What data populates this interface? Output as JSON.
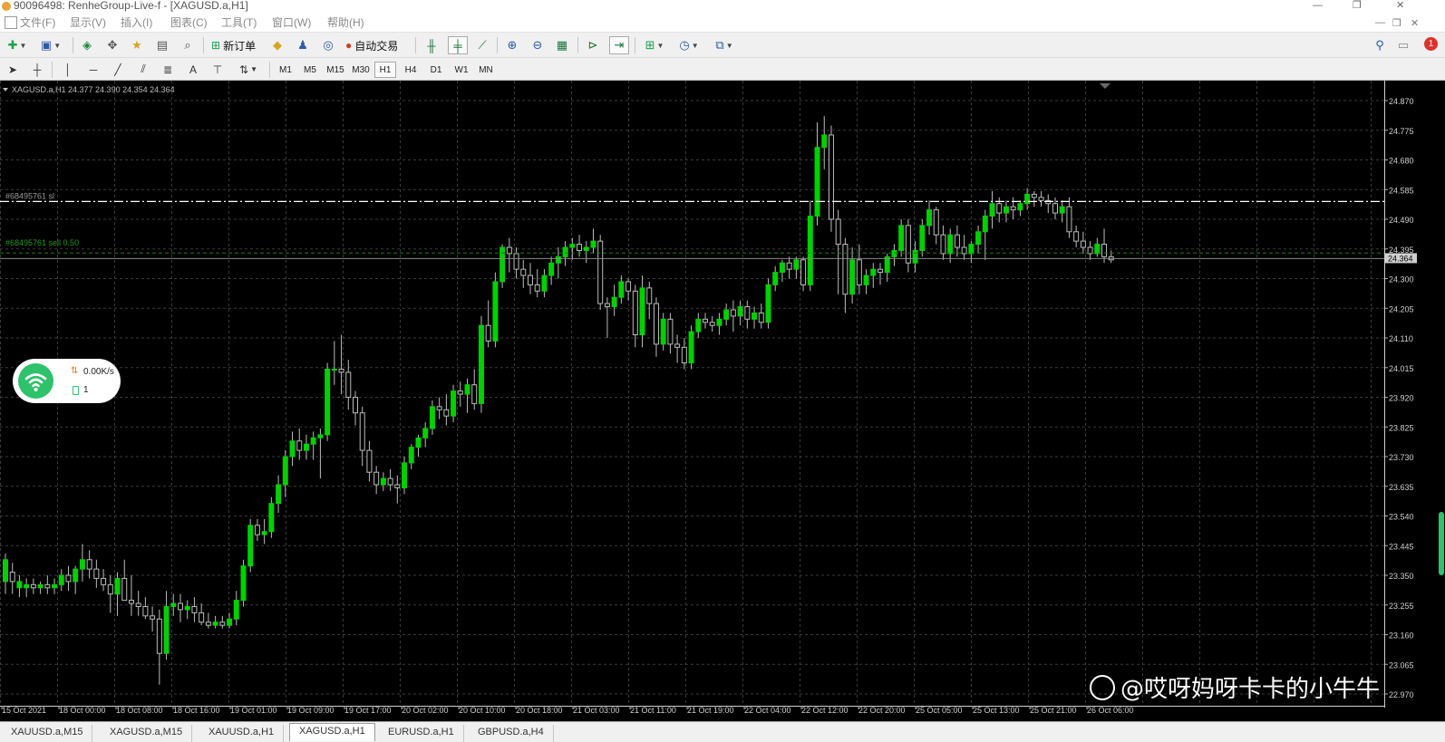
{
  "window": {
    "title": "90096498: RenheGroup-Live-f - [XAGUSD.a,H1]",
    "controls": [
      "—",
      "❐",
      "✕"
    ],
    "mdi_controls": [
      "—",
      "❐",
      "✕"
    ]
  },
  "menu": [
    "文件(F)",
    "显示(V)",
    "插入(I)",
    "图表(C)",
    "工具(T)",
    "窗口(W)",
    "帮助(H)"
  ],
  "toolbar": {
    "new_order_label": "新订单",
    "auto_trade_label": "自动交易",
    "notification_count": "1"
  },
  "timeframes": [
    "M1",
    "M5",
    "M15",
    "M30",
    "H1",
    "H4",
    "D1",
    "W1",
    "MN"
  ],
  "active_timeframe": "H1",
  "chart": {
    "header": "XAGUSD.a,H1  24.377 24.390 24.354 24.364",
    "sl_label": "#68495761 sl",
    "order_label": "#68495761 sell 0.50",
    "current_price_label": "24.364",
    "price_levels": [
      "24.870",
      "24.775",
      "24.680",
      "24.585",
      "24.490",
      "24.395",
      "24.300",
      "24.205",
      "24.110",
      "24.015",
      "23.920",
      "23.825",
      "23.730",
      "23.635",
      "23.540",
      "23.445",
      "23.350",
      "23.255",
      "23.160",
      "23.065",
      "22.970"
    ],
    "time_labels": [
      "15 Oct 2021",
      "18 Oct 00:00",
      "18 Oct 08:00",
      "18 Oct 16:00",
      "19 Oct 01:00",
      "19 Oct 09:00",
      "19 Oct 17:00",
      "20 Oct 02:00",
      "20 Oct 10:00",
      "20 Oct 18:00",
      "21 Oct 03:00",
      "21 Oct 11:00",
      "21 Oct 19:00",
      "22 Oct 04:00",
      "22 Oct 12:00",
      "22 Oct 20:00",
      "25 Oct 05:00",
      "25 Oct 13:00",
      "25 Oct 21:00",
      "26 Oct 06:00"
    ],
    "colors": {
      "background": "#000000",
      "bull": "#00d000",
      "bear": "#000000",
      "bear_outline": "#bcbcbc",
      "wick": "#bcbcbc",
      "grid": "#3a3a3a",
      "sl_line": "#ffffff",
      "order_line": "#1c7a1c",
      "bid_line": "#8a8a8a"
    }
  },
  "net_widget": {
    "speed": "0.00K/s",
    "count": "1"
  },
  "watermark": "@哎呀妈呀卡卡的小牛牛",
  "tabs": [
    "XAUUSD.a,M15",
    "XAGUSD.a,M15",
    "XAUUSD.a,H1",
    "XAGUSD.a,H1",
    "EURUSD.a,H1",
    "GBPUSD.a,H4"
  ],
  "active_tab": "XAGUSD.a,H1",
  "chart_data": {
    "type": "candlestick",
    "symbol": "XAGUSD.a",
    "timeframe": "H1",
    "ylim": [
      22.97,
      24.87
    ],
    "candles": [
      {
        "o": 23.33,
        "h": 23.42,
        "l": 23.29,
        "c": 23.4
      },
      {
        "o": 23.36,
        "h": 23.39,
        "l": 23.29,
        "c": 23.33
      },
      {
        "o": 23.31,
        "h": 23.35,
        "l": 23.28,
        "c": 23.33
      },
      {
        "o": 23.31,
        "h": 23.34,
        "l": 23.28,
        "c": 23.32
      },
      {
        "o": 23.32,
        "h": 23.34,
        "l": 23.29,
        "c": 23.31
      },
      {
        "o": 23.31,
        "h": 23.33,
        "l": 23.29,
        "c": 23.32
      },
      {
        "o": 23.32,
        "h": 23.35,
        "l": 23.29,
        "c": 23.31
      },
      {
        "o": 23.31,
        "h": 23.34,
        "l": 23.29,
        "c": 23.32
      },
      {
        "o": 23.32,
        "h": 23.37,
        "l": 23.3,
        "c": 23.35
      },
      {
        "o": 23.35,
        "h": 23.38,
        "l": 23.3,
        "c": 23.33
      },
      {
        "o": 23.33,
        "h": 23.38,
        "l": 23.29,
        "c": 23.37
      },
      {
        "o": 23.37,
        "h": 23.45,
        "l": 23.33,
        "c": 23.4
      },
      {
        "o": 23.4,
        "h": 23.43,
        "l": 23.34,
        "c": 23.37
      },
      {
        "o": 23.37,
        "h": 23.4,
        "l": 23.31,
        "c": 23.34
      },
      {
        "o": 23.34,
        "h": 23.37,
        "l": 23.3,
        "c": 23.32
      },
      {
        "o": 23.32,
        "h": 23.35,
        "l": 23.23,
        "c": 23.29
      },
      {
        "o": 23.29,
        "h": 23.36,
        "l": 23.22,
        "c": 23.34
      },
      {
        "o": 23.34,
        "h": 23.4,
        "l": 23.3,
        "c": 23.27
      },
      {
        "o": 23.27,
        "h": 23.35,
        "l": 23.22,
        "c": 23.26
      },
      {
        "o": 23.26,
        "h": 23.3,
        "l": 23.22,
        "c": 23.25
      },
      {
        "o": 23.25,
        "h": 23.28,
        "l": 23.21,
        "c": 23.22
      },
      {
        "o": 23.22,
        "h": 23.25,
        "l": 23.17,
        "c": 23.21
      },
      {
        "o": 23.21,
        "h": 23.24,
        "l": 23.0,
        "c": 23.1
      },
      {
        "o": 23.1,
        "h": 23.3,
        "l": 23.08,
        "c": 23.25
      },
      {
        "o": 23.25,
        "h": 23.29,
        "l": 23.22,
        "c": 23.26
      },
      {
        "o": 23.26,
        "h": 23.29,
        "l": 23.2,
        "c": 23.24
      },
      {
        "o": 23.24,
        "h": 23.27,
        "l": 23.21,
        "c": 23.25
      },
      {
        "o": 23.25,
        "h": 23.28,
        "l": 23.2,
        "c": 23.23
      },
      {
        "o": 23.23,
        "h": 23.26,
        "l": 23.19,
        "c": 23.2
      },
      {
        "o": 23.2,
        "h": 23.23,
        "l": 23.18,
        "c": 23.19
      },
      {
        "o": 23.19,
        "h": 23.22,
        "l": 23.18,
        "c": 23.2
      },
      {
        "o": 23.2,
        "h": 23.22,
        "l": 23.18,
        "c": 23.19
      },
      {
        "o": 23.19,
        "h": 23.23,
        "l": 23.18,
        "c": 23.21
      },
      {
        "o": 23.21,
        "h": 23.3,
        "l": 23.19,
        "c": 23.27
      },
      {
        "o": 23.27,
        "h": 23.4,
        "l": 23.25,
        "c": 23.38
      },
      {
        "o": 23.38,
        "h": 23.53,
        "l": 23.36,
        "c": 23.51
      },
      {
        "o": 23.51,
        "h": 23.53,
        "l": 23.46,
        "c": 23.48
      },
      {
        "o": 23.48,
        "h": 23.53,
        "l": 23.45,
        "c": 23.49
      },
      {
        "o": 23.49,
        "h": 23.6,
        "l": 23.47,
        "c": 23.58
      },
      {
        "o": 23.58,
        "h": 23.67,
        "l": 23.55,
        "c": 23.64
      },
      {
        "o": 23.64,
        "h": 23.75,
        "l": 23.6,
        "c": 23.73
      },
      {
        "o": 23.73,
        "h": 23.81,
        "l": 23.7,
        "c": 23.78
      },
      {
        "o": 23.78,
        "h": 23.82,
        "l": 23.72,
        "c": 23.75
      },
      {
        "o": 23.75,
        "h": 23.8,
        "l": 23.72,
        "c": 23.77
      },
      {
        "o": 23.77,
        "h": 23.81,
        "l": 23.72,
        "c": 23.79
      },
      {
        "o": 23.79,
        "h": 23.82,
        "l": 23.66,
        "c": 23.8
      },
      {
        "o": 23.8,
        "h": 24.03,
        "l": 23.78,
        "c": 24.01
      },
      {
        "o": 24.01,
        "h": 24.1,
        "l": 23.96,
        "c": 24.01
      },
      {
        "o": 24.01,
        "h": 24.12,
        "l": 23.93,
        "c": 24.0
      },
      {
        "o": 24.0,
        "h": 24.04,
        "l": 23.88,
        "c": 23.92
      },
      {
        "o": 23.92,
        "h": 23.94,
        "l": 23.83,
        "c": 23.87
      },
      {
        "o": 23.87,
        "h": 23.89,
        "l": 23.7,
        "c": 23.75
      },
      {
        "o": 23.75,
        "h": 23.78,
        "l": 23.65,
        "c": 23.68
      },
      {
        "o": 23.68,
        "h": 23.7,
        "l": 23.61,
        "c": 23.64
      },
      {
        "o": 23.64,
        "h": 23.68,
        "l": 23.62,
        "c": 23.66
      },
      {
        "o": 23.66,
        "h": 23.69,
        "l": 23.62,
        "c": 23.64
      },
      {
        "o": 23.64,
        "h": 23.67,
        "l": 23.58,
        "c": 23.63
      },
      {
        "o": 23.63,
        "h": 23.73,
        "l": 23.61,
        "c": 23.71
      },
      {
        "o": 23.71,
        "h": 23.77,
        "l": 23.69,
        "c": 23.76
      },
      {
        "o": 23.76,
        "h": 23.8,
        "l": 23.73,
        "c": 23.79
      },
      {
        "o": 23.79,
        "h": 23.84,
        "l": 23.76,
        "c": 23.82
      },
      {
        "o": 23.82,
        "h": 23.91,
        "l": 23.8,
        "c": 23.89
      },
      {
        "o": 23.89,
        "h": 23.92,
        "l": 23.85,
        "c": 23.88
      },
      {
        "o": 23.88,
        "h": 23.93,
        "l": 23.83,
        "c": 23.86
      },
      {
        "o": 23.86,
        "h": 23.96,
        "l": 23.84,
        "c": 23.94
      },
      {
        "o": 23.94,
        "h": 23.97,
        "l": 23.89,
        "c": 23.93
      },
      {
        "o": 23.93,
        "h": 23.98,
        "l": 23.87,
        "c": 23.96
      },
      {
        "o": 23.96,
        "h": 24.01,
        "l": 23.88,
        "c": 23.9
      },
      {
        "o": 23.9,
        "h": 24.18,
        "l": 23.87,
        "c": 24.15
      },
      {
        "o": 24.15,
        "h": 24.23,
        "l": 24.08,
        "c": 24.1
      },
      {
        "o": 24.1,
        "h": 24.32,
        "l": 24.08,
        "c": 24.29
      },
      {
        "o": 24.29,
        "h": 24.41,
        "l": 24.27,
        "c": 24.4
      },
      {
        "o": 24.4,
        "h": 24.43,
        "l": 24.32,
        "c": 24.38
      },
      {
        "o": 24.38,
        "h": 24.4,
        "l": 24.3,
        "c": 24.33
      },
      {
        "o": 24.33,
        "h": 24.36,
        "l": 24.27,
        "c": 24.31
      },
      {
        "o": 24.31,
        "h": 24.35,
        "l": 24.25,
        "c": 24.28
      },
      {
        "o": 24.28,
        "h": 24.33,
        "l": 24.24,
        "c": 24.26
      },
      {
        "o": 24.26,
        "h": 24.33,
        "l": 24.24,
        "c": 24.31
      },
      {
        "o": 24.31,
        "h": 24.37,
        "l": 24.28,
        "c": 24.35
      },
      {
        "o": 24.35,
        "h": 24.4,
        "l": 24.3,
        "c": 24.37
      },
      {
        "o": 24.37,
        "h": 24.42,
        "l": 24.34,
        "c": 24.4
      },
      {
        "o": 24.4,
        "h": 24.43,
        "l": 24.36,
        "c": 24.41
      },
      {
        "o": 24.41,
        "h": 24.44,
        "l": 24.37,
        "c": 24.39
      },
      {
        "o": 24.39,
        "h": 24.42,
        "l": 24.35,
        "c": 24.4
      },
      {
        "o": 24.4,
        "h": 24.46,
        "l": 24.38,
        "c": 24.42
      },
      {
        "o": 24.42,
        "h": 24.44,
        "l": 24.2,
        "c": 24.22
      },
      {
        "o": 24.22,
        "h": 24.24,
        "l": 24.11,
        "c": 24.21
      },
      {
        "o": 24.21,
        "h": 24.28,
        "l": 24.18,
        "c": 24.24
      },
      {
        "o": 24.24,
        "h": 24.31,
        "l": 24.22,
        "c": 24.29
      },
      {
        "o": 24.29,
        "h": 24.3,
        "l": 24.23,
        "c": 24.26
      },
      {
        "o": 24.26,
        "h": 24.28,
        "l": 24.08,
        "c": 24.12
      },
      {
        "o": 24.12,
        "h": 24.31,
        "l": 24.08,
        "c": 24.27
      },
      {
        "o": 24.27,
        "h": 24.29,
        "l": 24.17,
        "c": 24.22
      },
      {
        "o": 24.22,
        "h": 24.24,
        "l": 24.05,
        "c": 24.09
      },
      {
        "o": 24.09,
        "h": 24.19,
        "l": 24.07,
        "c": 24.17
      },
      {
        "o": 24.17,
        "h": 24.19,
        "l": 24.06,
        "c": 24.09
      },
      {
        "o": 24.09,
        "h": 24.12,
        "l": 24.03,
        "c": 24.08
      },
      {
        "o": 24.08,
        "h": 24.11,
        "l": 24.01,
        "c": 24.03
      },
      {
        "o": 24.03,
        "h": 24.15,
        "l": 24.01,
        "c": 24.13
      },
      {
        "o": 24.13,
        "h": 24.19,
        "l": 24.11,
        "c": 24.17
      },
      {
        "o": 24.17,
        "h": 24.19,
        "l": 24.14,
        "c": 24.16
      },
      {
        "o": 24.16,
        "h": 24.18,
        "l": 24.13,
        "c": 24.15
      },
      {
        "o": 24.15,
        "h": 24.19,
        "l": 24.12,
        "c": 24.17
      },
      {
        "o": 24.17,
        "h": 24.22,
        "l": 24.15,
        "c": 24.2
      },
      {
        "o": 24.2,
        "h": 24.23,
        "l": 24.13,
        "c": 24.18
      },
      {
        "o": 24.18,
        "h": 24.23,
        "l": 24.15,
        "c": 24.21
      },
      {
        "o": 24.21,
        "h": 24.23,
        "l": 24.14,
        "c": 24.17
      },
      {
        "o": 24.17,
        "h": 24.21,
        "l": 24.14,
        "c": 24.19
      },
      {
        "o": 24.19,
        "h": 24.22,
        "l": 24.14,
        "c": 24.16
      },
      {
        "o": 24.16,
        "h": 24.3,
        "l": 24.14,
        "c": 24.28
      },
      {
        "o": 24.28,
        "h": 24.34,
        "l": 24.26,
        "c": 24.32
      },
      {
        "o": 24.32,
        "h": 24.36,
        "l": 24.29,
        "c": 24.35
      },
      {
        "o": 24.35,
        "h": 24.37,
        "l": 24.3,
        "c": 24.33
      },
      {
        "o": 24.33,
        "h": 24.37,
        "l": 24.3,
        "c": 24.36
      },
      {
        "o": 24.36,
        "h": 24.37,
        "l": 24.26,
        "c": 24.28
      },
      {
        "o": 24.28,
        "h": 24.55,
        "l": 24.26,
        "c": 24.5
      },
      {
        "o": 24.5,
        "h": 24.8,
        "l": 24.47,
        "c": 24.72
      },
      {
        "o": 24.72,
        "h": 24.82,
        "l": 24.65,
        "c": 24.76
      },
      {
        "o": 24.76,
        "h": 24.79,
        "l": 24.45,
        "c": 24.49
      },
      {
        "o": 24.49,
        "h": 24.52,
        "l": 24.25,
        "c": 24.41
      },
      {
        "o": 24.41,
        "h": 24.43,
        "l": 24.19,
        "c": 24.25
      },
      {
        "o": 24.25,
        "h": 24.4,
        "l": 24.22,
        "c": 24.36
      },
      {
        "o": 24.36,
        "h": 24.41,
        "l": 24.25,
        "c": 24.28
      },
      {
        "o": 24.28,
        "h": 24.33,
        "l": 24.25,
        "c": 24.31
      },
      {
        "o": 24.31,
        "h": 24.35,
        "l": 24.27,
        "c": 24.33
      },
      {
        "o": 24.33,
        "h": 24.35,
        "l": 24.28,
        "c": 24.32
      },
      {
        "o": 24.32,
        "h": 24.38,
        "l": 24.29,
        "c": 24.37
      },
      {
        "o": 24.37,
        "h": 24.41,
        "l": 24.34,
        "c": 24.39
      },
      {
        "o": 24.39,
        "h": 24.49,
        "l": 24.37,
        "c": 24.47
      },
      {
        "o": 24.47,
        "h": 24.49,
        "l": 24.32,
        "c": 24.35
      },
      {
        "o": 24.35,
        "h": 24.42,
        "l": 24.32,
        "c": 24.39
      },
      {
        "o": 24.39,
        "h": 24.49,
        "l": 24.37,
        "c": 24.47
      },
      {
        "o": 24.47,
        "h": 24.55,
        "l": 24.44,
        "c": 24.52
      },
      {
        "o": 24.52,
        "h": 24.53,
        "l": 24.41,
        "c": 24.44
      },
      {
        "o": 24.44,
        "h": 24.47,
        "l": 24.36,
        "c": 24.38
      },
      {
        "o": 24.38,
        "h": 24.46,
        "l": 24.35,
        "c": 24.44
      },
      {
        "o": 24.44,
        "h": 24.47,
        "l": 24.37,
        "c": 24.4
      },
      {
        "o": 24.4,
        "h": 24.44,
        "l": 24.36,
        "c": 24.38
      },
      {
        "o": 24.38,
        "h": 24.42,
        "l": 24.35,
        "c": 24.41
      },
      {
        "o": 24.41,
        "h": 24.47,
        "l": 24.38,
        "c": 24.45
      },
      {
        "o": 24.45,
        "h": 24.52,
        "l": 24.36,
        "c": 24.5
      },
      {
        "o": 24.5,
        "h": 24.58,
        "l": 24.46,
        "c": 24.54
      },
      {
        "o": 24.54,
        "h": 24.56,
        "l": 24.48,
        "c": 24.51
      },
      {
        "o": 24.51,
        "h": 24.55,
        "l": 24.48,
        "c": 24.53
      },
      {
        "o": 24.53,
        "h": 24.56,
        "l": 24.49,
        "c": 24.52
      },
      {
        "o": 24.52,
        "h": 24.55,
        "l": 24.5,
        "c": 24.54
      },
      {
        "o": 24.54,
        "h": 24.59,
        "l": 24.52,
        "c": 24.57
      },
      {
        "o": 24.57,
        "h": 24.58,
        "l": 24.53,
        "c": 24.56
      },
      {
        "o": 24.56,
        "h": 24.58,
        "l": 24.53,
        "c": 24.55
      },
      {
        "o": 24.55,
        "h": 24.57,
        "l": 24.51,
        "c": 24.54
      },
      {
        "o": 24.54,
        "h": 24.56,
        "l": 24.49,
        "c": 24.51
      },
      {
        "o": 24.51,
        "h": 24.55,
        "l": 24.48,
        "c": 24.53
      },
      {
        "o": 24.53,
        "h": 24.56,
        "l": 24.43,
        "c": 24.45
      },
      {
        "o": 24.45,
        "h": 24.47,
        "l": 24.4,
        "c": 24.42
      },
      {
        "o": 24.42,
        "h": 24.45,
        "l": 24.38,
        "c": 24.4
      },
      {
        "o": 24.4,
        "h": 24.42,
        "l": 24.36,
        "c": 24.38
      },
      {
        "o": 24.38,
        "h": 24.43,
        "l": 24.37,
        "c": 24.41
      },
      {
        "o": 24.41,
        "h": 24.46,
        "l": 24.35,
        "c": 24.37
      },
      {
        "o": 24.37,
        "h": 24.39,
        "l": 24.35,
        "c": 24.36
      }
    ]
  }
}
